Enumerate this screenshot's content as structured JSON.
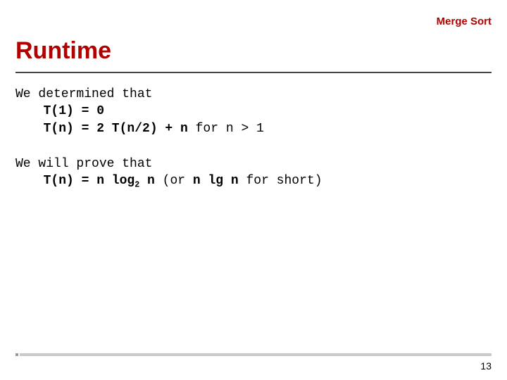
{
  "header": {
    "topic": "Merge Sort"
  },
  "title": "Runtime",
  "body": {
    "p1_lead": "We determined that",
    "p1_line1_b": "T(1) = 0",
    "p1_line2_b": "T(n) = 2 T(n/2) + n",
    "p1_line2_tail": "  for n > 1",
    "p2_lead": "We will prove that",
    "p2_eq_lhs": "T(n) = n log",
    "p2_eq_sub": "2",
    "p2_eq_rhs": " n",
    "p2_tail_open": "  (or ",
    "p2_tail_b": "n lg n",
    "p2_tail_close": " for short)"
  },
  "page_number": "13"
}
